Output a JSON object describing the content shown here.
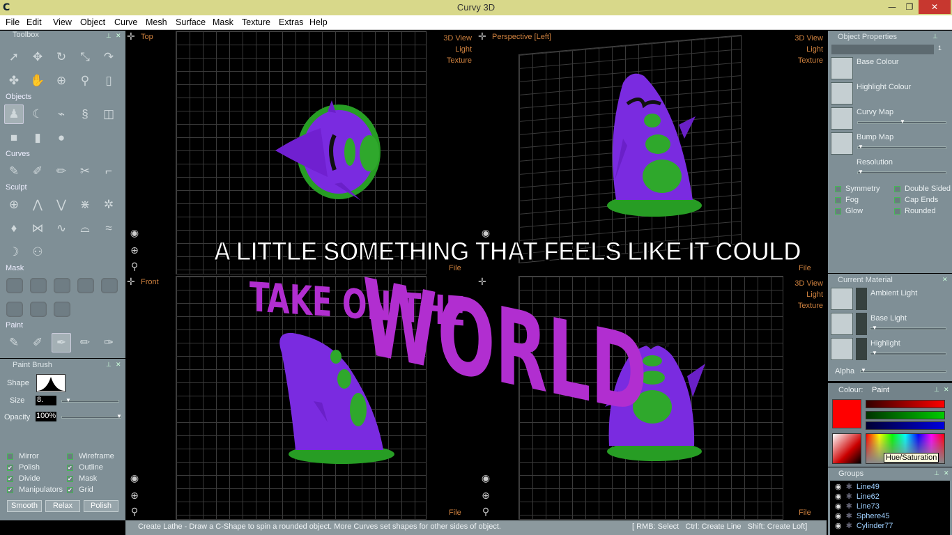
{
  "window": {
    "title": "Curvy 3D",
    "minimize": "—",
    "maximize": "❐",
    "close": "✕",
    "app_icon": "C"
  },
  "menu": [
    "File",
    "Edit",
    "View",
    "Object",
    "Curve",
    "Mesh",
    "Surface",
    "Mask",
    "Texture",
    "Extras",
    "Help"
  ],
  "toolbox": {
    "title": "Toolbox",
    "sections": {
      "objects": "Objects",
      "curves": "Curves",
      "sculpt": "Sculpt",
      "mask": "Mask",
      "paint": "Paint"
    }
  },
  "paint_brush": {
    "title": "Paint Brush",
    "shape_label": "Shape",
    "size_label": "Size",
    "size_value": "8.",
    "opacity_label": "Opacity",
    "opacity_value": "100%",
    "checks": [
      {
        "label": "Mirror",
        "checked": false
      },
      {
        "label": "Wireframe",
        "checked": false
      },
      {
        "label": "Polish",
        "checked": true
      },
      {
        "label": "Outline",
        "checked": true
      },
      {
        "label": "Divide",
        "checked": true
      },
      {
        "label": "Mask",
        "checked": true
      },
      {
        "label": "Manipulators",
        "checked": true
      },
      {
        "label": "Grid",
        "checked": true
      }
    ],
    "buttons": {
      "smooth": "Smooth",
      "relax": "Relax",
      "polish": "Polish"
    }
  },
  "viewports": {
    "top": {
      "label": "Top",
      "opts": [
        "3D View",
        "Light",
        "Texture"
      ],
      "file": "File"
    },
    "persp": {
      "label": "Perspective [Left]",
      "opts": [
        "3D View",
        "Light",
        "Texture"
      ],
      "file": "File"
    },
    "front": {
      "label": "Front",
      "file": "File"
    },
    "fourth": {
      "opts": [
        "3D View",
        "Light",
        "Texture"
      ],
      "file": "File"
    }
  },
  "object_properties": {
    "title": "Object Properties",
    "field_value": "1",
    "rows": [
      "Base Colour",
      "Highlight Colour",
      "Curvy Map",
      "Bump Map"
    ],
    "resolution": "Resolution",
    "checks_left": [
      "Symmetry",
      "Fog",
      "Glow"
    ],
    "checks_right": [
      "Double Sided",
      "Cap Ends",
      "Rounded"
    ]
  },
  "current_material": {
    "title": "Current Material",
    "rows": [
      "Ambient Light",
      "Base Light",
      "Highlight"
    ],
    "alpha": "Alpha"
  },
  "colour": {
    "title": "Colour:",
    "tab": "Paint",
    "tooltip": "Hue/Saturation",
    "swatch": "#ff0000"
  },
  "groups": {
    "title": "Groups",
    "items": [
      "Line49",
      "Line62",
      "Line73",
      "Sphere45",
      "Cylinder77"
    ]
  },
  "status": {
    "message": "Create Lathe - Draw a C-Shape to spin a rounded object. More Curves set shapes for other sides of object.",
    "hints": "[ RMB: Select   Ctrl: Create Line   Shift: Create Loft]"
  },
  "overlay": {
    "line1": "A LITTLE SOMETHING THAT FEELS LIKE IT COULD",
    "line2a": "TAKE ON THE",
    "line2b": "WORLD"
  },
  "colors": {
    "purple": "#7a2be0",
    "green": "#2fa82c",
    "accent": "#d0823f",
    "panel": "#7f8f96"
  }
}
